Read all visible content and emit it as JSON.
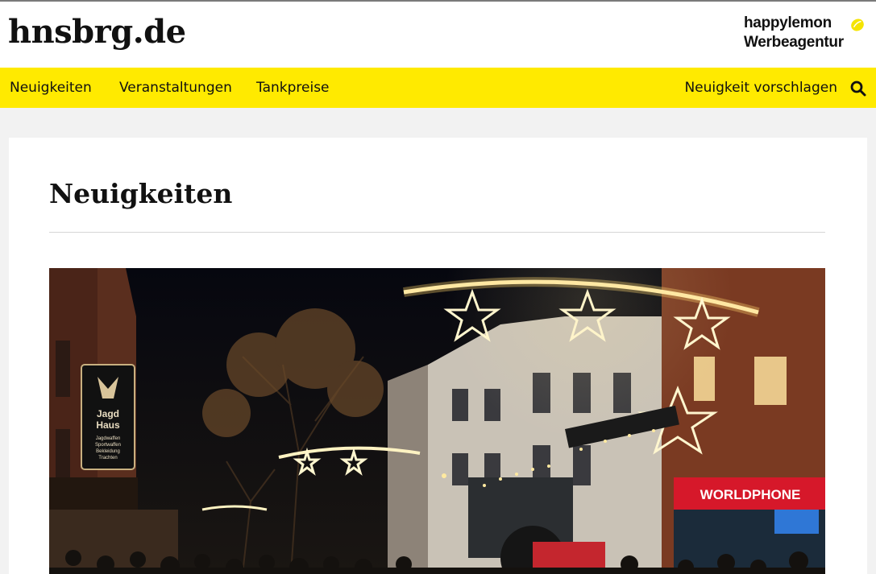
{
  "site": {
    "logo": "hnsbrg.de",
    "sponsor_line1": "happylemon",
    "sponsor_line2": "Werbeagentur"
  },
  "nav": {
    "items": [
      {
        "label": "Neuigkeiten"
      },
      {
        "label": "Veranstaltungen"
      },
      {
        "label": "Tankpreise"
      }
    ],
    "suggest_label": "Neuigkeit vorschlagen"
  },
  "main": {
    "title": "Neuigkeiten"
  },
  "photo": {
    "signs": {
      "jagd_line1": "Jagd",
      "jagd_line2": "Haus",
      "jagd_sub1": "Jagdwaffen",
      "jagd_sub2": "Sportwaffen",
      "jagd_sub3": "Bekleidung",
      "jagd_sub4": "Trachten",
      "shop": "WORLDPHONE"
    }
  },
  "colors": {
    "nav_bg": "#ffea00",
    "page_bg": "#f2f2f2",
    "lemon": "#f5e400"
  },
  "icons": [
    "lemon-icon",
    "search-icon"
  ]
}
